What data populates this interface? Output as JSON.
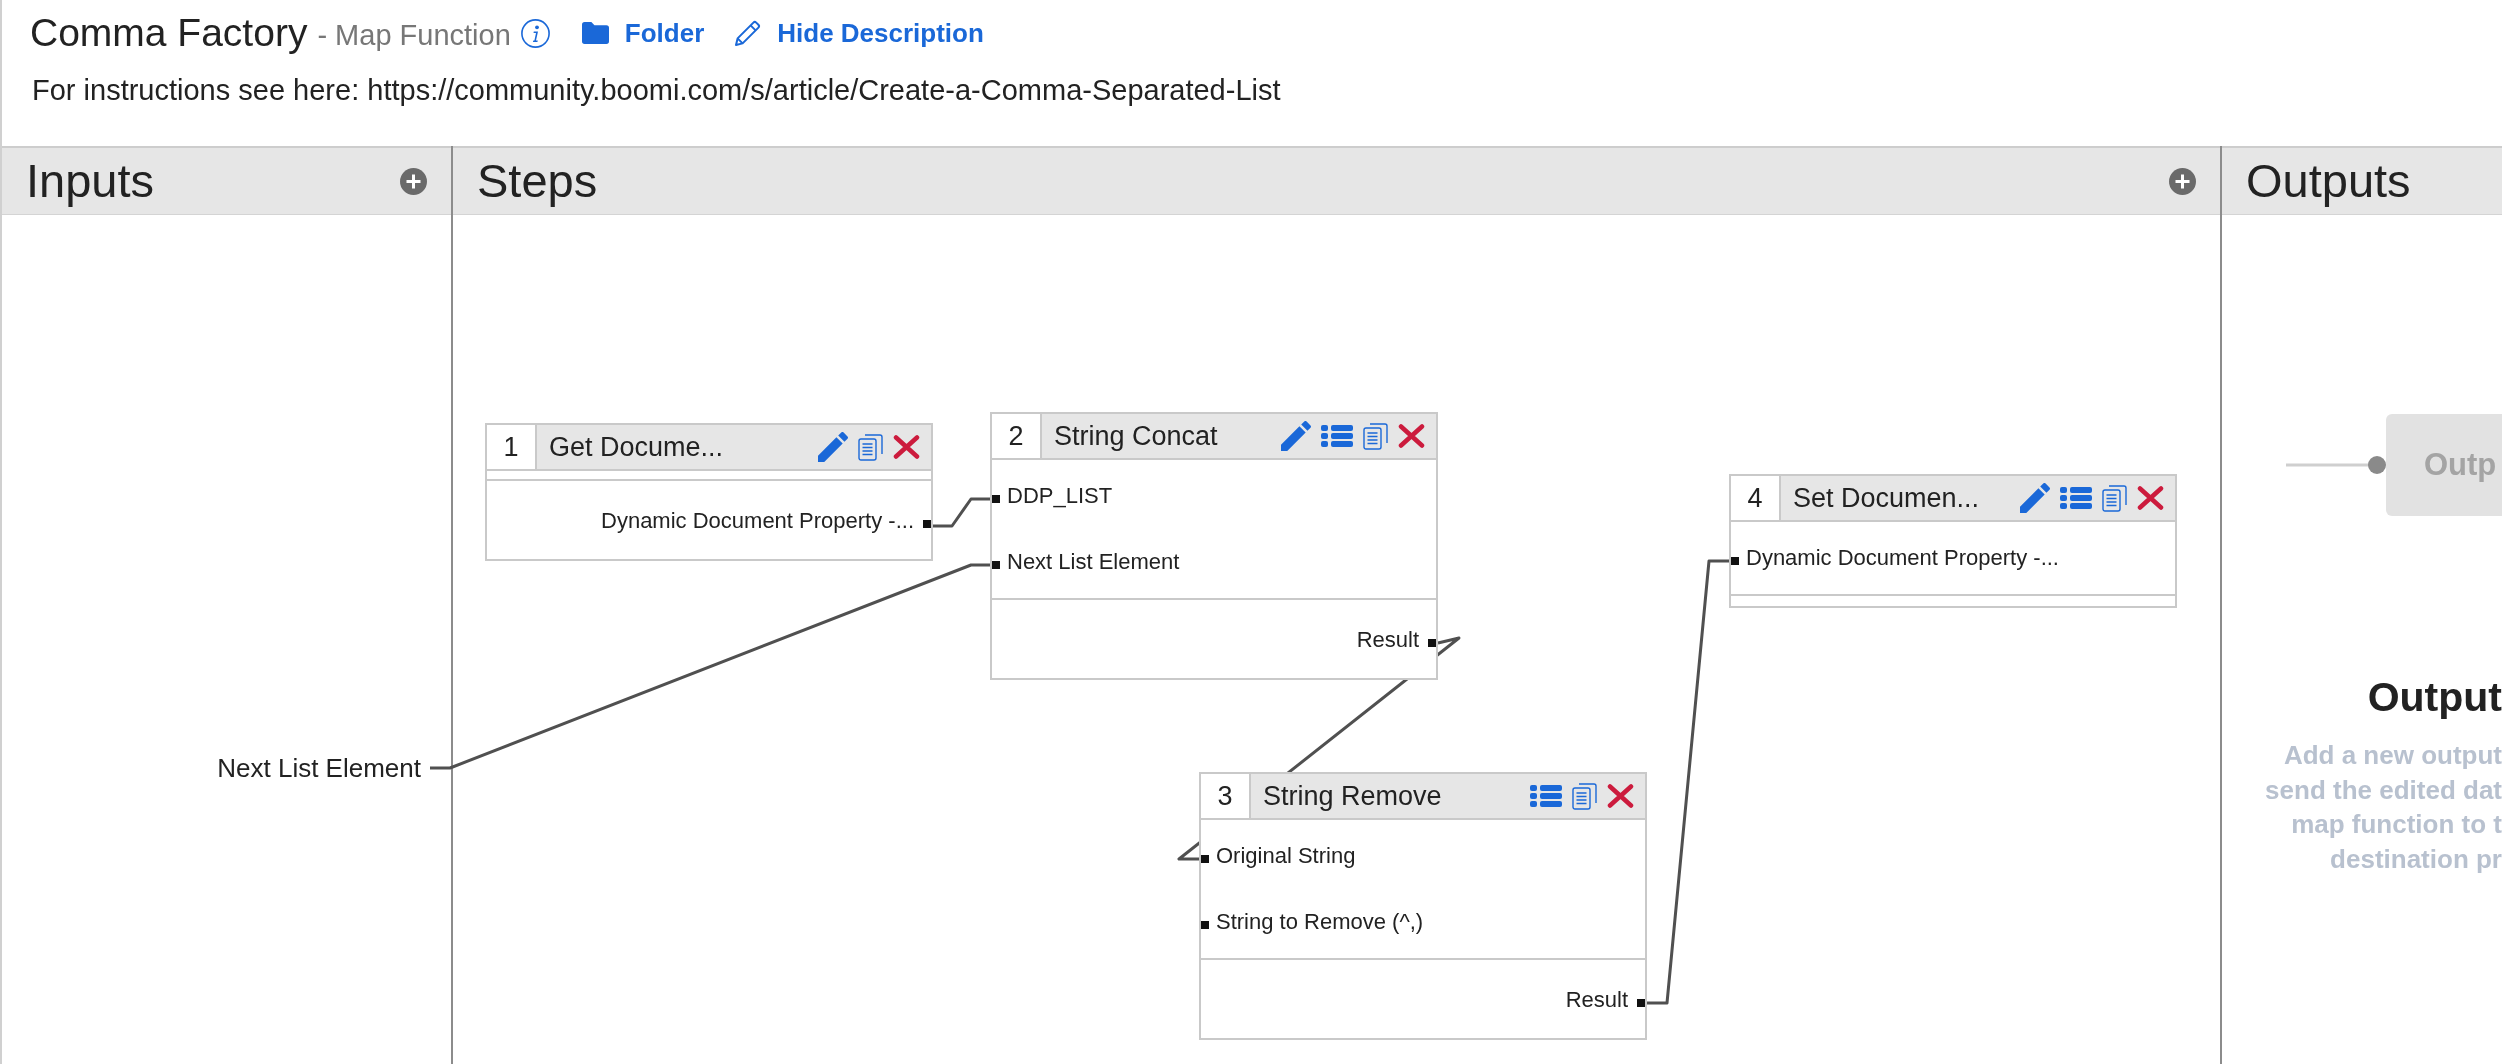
{
  "header": {
    "title": "Comma Factory",
    "subtitle": "- Map Function",
    "links": [
      {
        "kind": "folder",
        "label": "Folder"
      },
      {
        "kind": "edit",
        "label": "Hide Description"
      }
    ],
    "description": "For instructions see here: https://community.boomi.com/s/article/Create-a-Comma-Separated-List"
  },
  "inputs": {
    "title": "Inputs",
    "fields": [
      {
        "label": "Next List Element"
      }
    ]
  },
  "steps": {
    "title": "Steps",
    "items": [
      {
        "number": "1",
        "name": "Get Docume...",
        "actions": [
          {
            "kind": "edit"
          },
          {
            "kind": "copy"
          },
          {
            "kind": "delete"
          }
        ],
        "outputs": [
          {
            "label": "Dynamic Document Property -..."
          }
        ]
      },
      {
        "number": "2",
        "name": "String Concat",
        "actions": [
          {
            "kind": "edit"
          },
          {
            "kind": "list"
          },
          {
            "kind": "copy"
          },
          {
            "kind": "delete"
          }
        ],
        "inputs": [
          {
            "label": "DDP_LIST"
          },
          {
            "label": "Next List Element"
          }
        ],
        "outputs": [
          {
            "label": "Result"
          }
        ]
      },
      {
        "number": "3",
        "name": "String Remove",
        "actions": [
          {
            "kind": "list"
          },
          {
            "kind": "copy"
          },
          {
            "kind": "delete"
          }
        ],
        "inputs": [
          {
            "label": "Original String"
          },
          {
            "label": "String to Remove (^,)"
          }
        ],
        "outputs": [
          {
            "label": "Result"
          }
        ]
      },
      {
        "number": "4",
        "name": "Set Documen...",
        "actions": [
          {
            "kind": "edit"
          },
          {
            "kind": "list"
          },
          {
            "kind": "copy"
          },
          {
            "kind": "delete"
          }
        ],
        "inputs": [
          {
            "label": "Dynamic Document Property -..."
          }
        ]
      }
    ]
  },
  "outputs": {
    "title": "Outputs",
    "ghost_node": "Outp",
    "empty_title": "Output",
    "empty_hint_lines": [
      "Add a new output",
      "send the edited dat",
      "map function to t",
      "destination pr"
    ]
  }
}
